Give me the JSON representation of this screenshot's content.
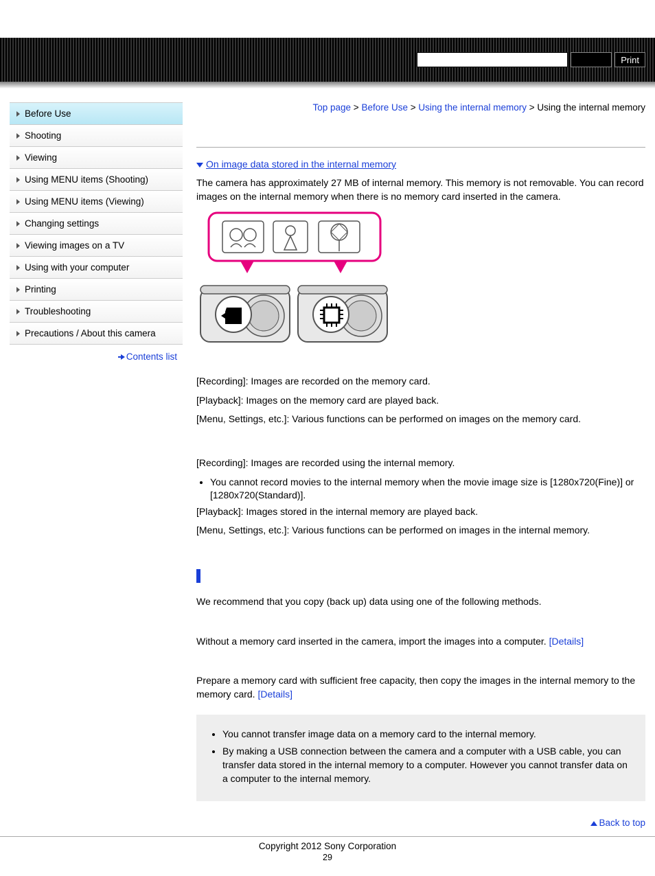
{
  "header": {
    "search_placeholder": "",
    "search_button": "",
    "print_button": "Print"
  },
  "breadcrumb": {
    "items": [
      "Top page",
      "Before Use",
      "Using the internal memory",
      "Using the internal memory"
    ],
    "sep": ">"
  },
  "sidebar": {
    "items": [
      {
        "label": "Before Use",
        "active": true
      },
      {
        "label": "Shooting"
      },
      {
        "label": "Viewing"
      },
      {
        "label": "Using MENU items (Shooting)"
      },
      {
        "label": "Using MENU items (Viewing)"
      },
      {
        "label": "Changing settings"
      },
      {
        "label": "Viewing images on a TV"
      },
      {
        "label": "Using with your computer"
      },
      {
        "label": "Printing"
      },
      {
        "label": "Troubleshooting"
      },
      {
        "label": "Precautions / About this camera"
      }
    ],
    "contents_list": "Contents list"
  },
  "main": {
    "toc_link": "On image data stored in the internal memory",
    "intro": "The camera has approximately 27 MB of internal memory. This memory is not removable. You can record images on the internal memory when there is no memory card inserted in the camera.",
    "block_a": {
      "recording": "[Recording]: Images are recorded on the memory card.",
      "playback": "[Playback]: Images on the memory card are played back.",
      "menu": "[Menu, Settings, etc.]: Various functions can be performed on images on the memory card."
    },
    "block_b": {
      "recording": "[Recording]: Images are recorded using the internal memory.",
      "bullet": "You cannot record movies to the internal memory when the movie image size is [1280x720(Fine)] or [1280x720(Standard)].",
      "playback": "[Playback]: Images stored in the internal memory are played back.",
      "menu": "[Menu, Settings, etc.]: Various functions can be performed on images in the internal memory."
    },
    "recommend": "We recommend that you copy (back up) data using one of the following methods.",
    "method1": {
      "text": "Without a memory card inserted in the camera, import the images into a computer. ",
      "details": "[Details]"
    },
    "method2": {
      "text": "Prepare a memory card with sufficient free capacity, then copy the images in the internal memory to the memory card. ",
      "details": "[Details]"
    },
    "notes": [
      "You cannot transfer image data on a memory card to the internal memory.",
      "By making a USB connection between the camera and a computer with a USB cable, you can transfer data stored in the internal memory to a computer. However you cannot transfer data on a computer to the internal memory."
    ],
    "back_to_top": "Back to top"
  },
  "footer": {
    "copyright": "Copyright 2012 Sony Corporation",
    "page_number": "29"
  }
}
